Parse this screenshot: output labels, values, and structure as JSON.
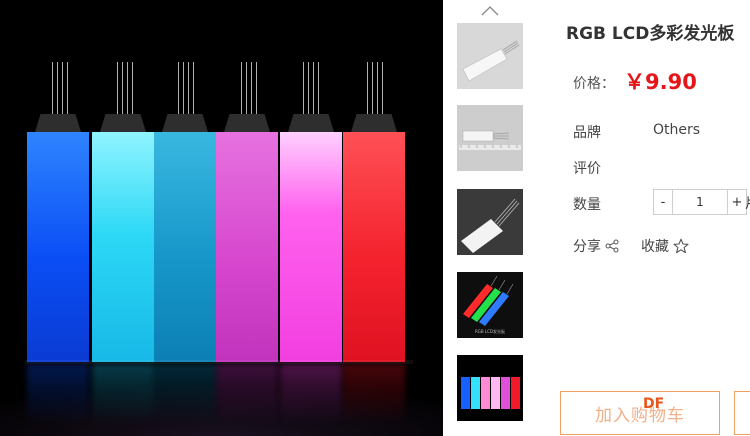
{
  "product": {
    "title": "RGB LCD多彩发光板",
    "price_label": "价格：",
    "price": "￥9.90"
  },
  "attributes": {
    "brand_label": "品牌",
    "brand_value": "Others",
    "rating_label": "评价",
    "quantity_label": "数量"
  },
  "quantity": {
    "decrement": "-",
    "value": "1",
    "increment": "+",
    "unit_partial": "片"
  },
  "actions": {
    "share_label": "分享",
    "favorite_label": "收藏",
    "add_to_cart_label": "加入购物车",
    "add_to_cart_overlay": "DF"
  },
  "thumbnails": {
    "icons": [
      "chevron-up-icon"
    ],
    "items": [
      {
        "name": "thumbnail-white-panel"
      },
      {
        "name": "thumbnail-panel-ruler"
      },
      {
        "name": "thumbnail-panel-angled"
      },
      {
        "name": "thumbnail-rgb-panels"
      },
      {
        "name": "thumbnail-colorful-panels"
      }
    ],
    "thumb4_caption": "RGB LCD发光板"
  },
  "panel_colors": [
    "#1560ff",
    "#33e1ff",
    "#18a3d6",
    "#e04fd8",
    "#ff4fea",
    "#f21a2a"
  ],
  "colors": {
    "price": "#e4161a",
    "accent_orange": "#f0a060"
  }
}
